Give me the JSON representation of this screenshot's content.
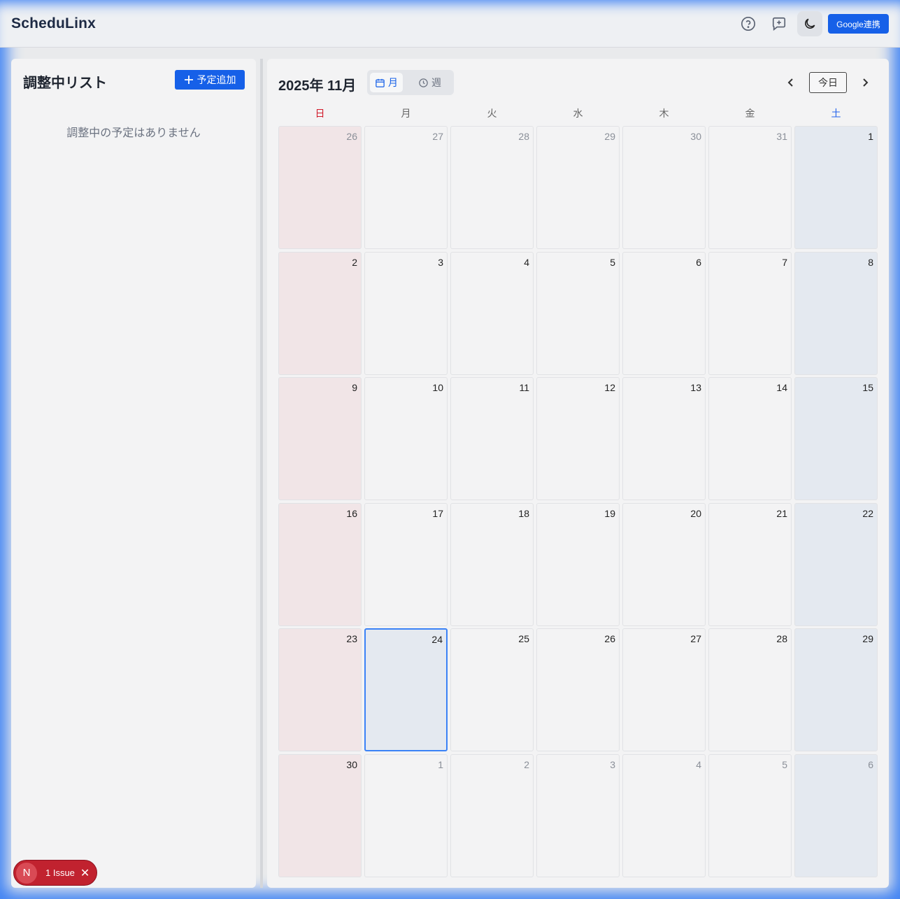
{
  "app": {
    "title": "ScheduLinx"
  },
  "header": {
    "icons": [
      "help-icon",
      "feedback-icon",
      "dark-mode-icon"
    ],
    "google_button": "Google連携"
  },
  "pending": {
    "title": "調整中リスト",
    "add_button": "予定追加",
    "empty_message": "調整中の予定はありません"
  },
  "calendar": {
    "title": "2025年 11月",
    "view_month": "月",
    "view_week": "週",
    "today_button": "今日",
    "weekdays": [
      "日",
      "月",
      "火",
      "水",
      "木",
      "金",
      "土"
    ],
    "weeks": [
      [
        26,
        27,
        28,
        29,
        30,
        31,
        1
      ],
      [
        2,
        3,
        4,
        5,
        6,
        7,
        8
      ],
      [
        9,
        10,
        11,
        12,
        13,
        14,
        15
      ],
      [
        16,
        17,
        18,
        19,
        20,
        21,
        22
      ],
      [
        23,
        24,
        25,
        26,
        27,
        28,
        29
      ],
      [
        30,
        1,
        2,
        3,
        4,
        5,
        6
      ]
    ],
    "today": 24
  },
  "issue_badge": {
    "avatar": "N",
    "label": "1 Issue"
  },
  "colors": {
    "accent": "#1660e8",
    "sunday": "#d11a2a",
    "saturday": "#2563eb",
    "issue": "#c1222f"
  }
}
